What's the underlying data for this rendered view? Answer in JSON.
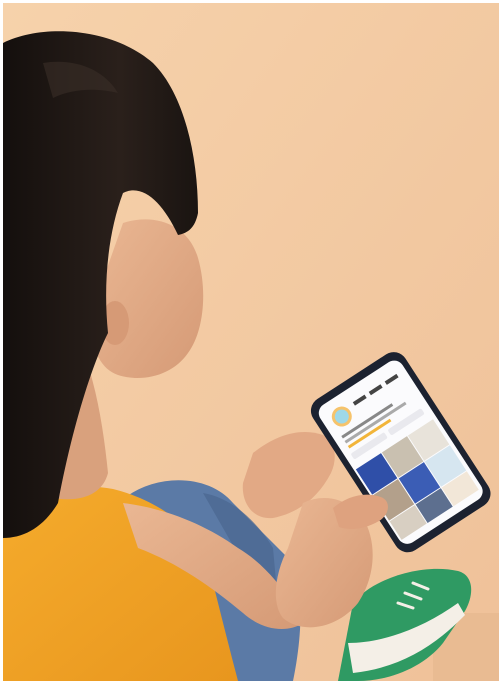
{
  "image": {
    "subject": "person-holding-smartphone",
    "colors": {
      "background": "#f3c99f",
      "hair": "#1e1714",
      "skin": "#e6b08c",
      "top": "#f2a326",
      "jeans": "#5b7aa6",
      "sneaker": "#2f9a63",
      "phone": "#1c2230"
    }
  }
}
